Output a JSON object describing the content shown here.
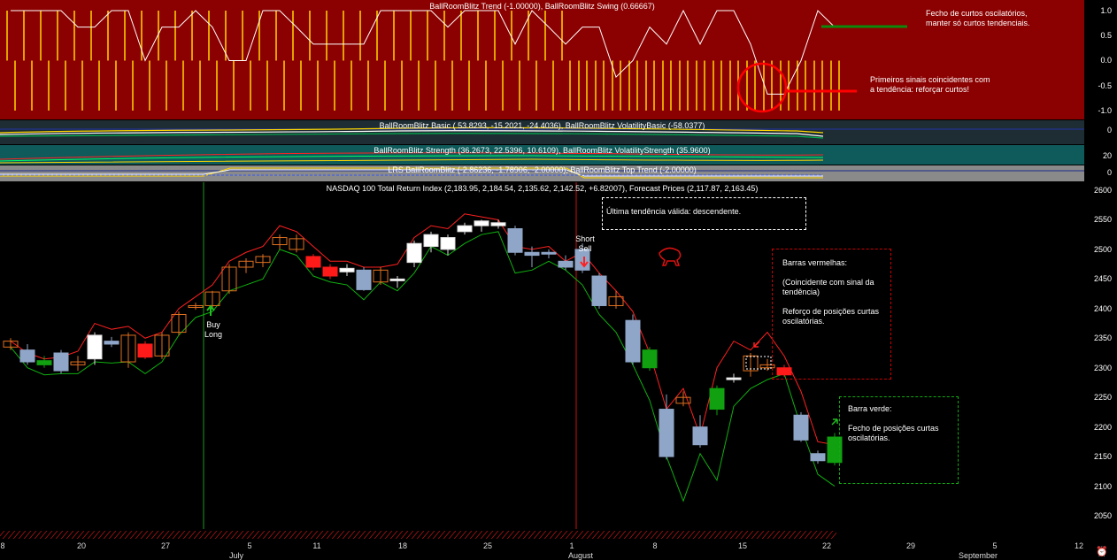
{
  "panels": {
    "trend": {
      "title": "BallRoomBlitz Trend (-1.00000), BallRoomBlitz Swing (0.66667)",
      "ticks": [
        "1.0",
        "0.5",
        "0.0",
        "-0.5",
        "-1.0"
      ],
      "ylim": [
        -1.0,
        1.0
      ],
      "colors": {
        "bg": "#8b0000",
        "bars": "#ffd700",
        "swing": "#ffffff",
        "green": "#0b8a0b",
        "red": "#ff0000"
      }
    },
    "basic": {
      "title": "BallRoomBlitz Basic ( 53.8293, -15.2021, -24.4036), BallRoomBlitz VolatilityBasic (-58.0377)",
      "ticks": [
        "0"
      ]
    },
    "strength": {
      "title": "BallRoomBlitz Strength (36.2673, 22.5396, 10.6109), BallRoomBlitz VolatilityStrength (35.9600)",
      "ticks": [
        "20",
        "0"
      ]
    },
    "lrs": {
      "title": "LRS BallRoomBlitz (-2.86236, -1.78906, -2.00000), BallRoomBlitz Top Trend (-2.00000)",
      "ticks": [
        "0"
      ]
    },
    "main": {
      "title": "NASDAQ 100 Total Return Index (2,183.95, 2,184.54, 2,135.62, 2,142.52, +6.82007), Forecast Prices (2,117.87, 2,163.45)",
      "ticks": [
        "2600",
        "2550",
        "2500",
        "2450",
        "2400",
        "2350",
        "2300",
        "2250",
        "2200",
        "2150",
        "2100",
        "2050"
      ]
    }
  },
  "annotations": {
    "trend_note1": "Fecho de curtos oscilatórios, manter só curtos tendenciais.",
    "trend_note2": "Primeiros sinais coincidentes com a tendência: reforçar curtos!",
    "box1": "Última tendência válida: descendente.",
    "box2_title": "Barras vermelhas:",
    "box2_line2": "(Coincidente com sinal da tendência)",
    "box2_line3": "Reforço de posições curtas oscilatórias.",
    "box3_title": "Barra verde:",
    "box3_line2": "Fecho de posições curtas oscilatórias.",
    "buy": "Buy Long",
    "sell": "Short Sell"
  },
  "x_axis": {
    "day_labels": [
      "8",
      "20",
      "27",
      "5",
      "11",
      "18",
      "25",
      "1",
      "8",
      "15",
      "22",
      "29",
      "5",
      "12"
    ],
    "month_labels": [
      "July",
      "August",
      "September"
    ]
  },
  "chart_data": {
    "type": "candlestick",
    "title": "NASDAQ 100 Total Return Index (2,183.95, 2,184.54, 2,135.62, 2,142.52, +6.82007), Forecast Prices (2,117.87, 2,163.45)",
    "ylim": [
      2025,
      2610
    ],
    "grid": false,
    "candles": [
      {
        "o": 2335,
        "h": 2350,
        "l": 2330,
        "c": 2345,
        "col": "orange"
      },
      {
        "o": 2330,
        "h": 2340,
        "l": 2305,
        "c": 2310,
        "col": "blue"
      },
      {
        "o": 2312,
        "h": 2320,
        "l": 2300,
        "c": 2305,
        "col": "green"
      },
      {
        "o": 2325,
        "h": 2330,
        "l": 2290,
        "c": 2295,
        "col": "blue"
      },
      {
        "o": 2305,
        "h": 2320,
        "l": 2295,
        "c": 2310,
        "col": "orange"
      },
      {
        "o": 2315,
        "h": 2360,
        "l": 2305,
        "c": 2355,
        "col": "white"
      },
      {
        "o": 2345,
        "h": 2352,
        "l": 2335,
        "c": 2340,
        "col": "blue"
      },
      {
        "o": 2310,
        "h": 2360,
        "l": 2300,
        "c": 2355,
        "col": "orange"
      },
      {
        "o": 2340,
        "h": 2345,
        "l": 2315,
        "c": 2318,
        "col": "red"
      },
      {
        "o": 2320,
        "h": 2360,
        "l": 2315,
        "c": 2355,
        "col": "orange"
      },
      {
        "o": 2360,
        "h": 2395,
        "l": 2355,
        "c": 2390,
        "col": "orange"
      },
      {
        "o": 2405,
        "h": 2410,
        "l": 2398,
        "c": 2403,
        "col": "orange"
      },
      {
        "o": 2405,
        "h": 2430,
        "l": 2400,
        "c": 2428,
        "col": "orange"
      },
      {
        "o": 2430,
        "h": 2475,
        "l": 2425,
        "c": 2470,
        "col": "orange"
      },
      {
        "o": 2470,
        "h": 2485,
        "l": 2460,
        "c": 2480,
        "col": "orange"
      },
      {
        "o": 2478,
        "h": 2492,
        "l": 2470,
        "c": 2488,
        "col": "orange"
      },
      {
        "o": 2508,
        "h": 2525,
        "l": 2500,
        "c": 2520,
        "col": "orange"
      },
      {
        "o": 2518,
        "h": 2525,
        "l": 2495,
        "c": 2500,
        "col": "orange"
      },
      {
        "o": 2488,
        "h": 2492,
        "l": 2465,
        "c": 2470,
        "col": "red"
      },
      {
        "o": 2470,
        "h": 2475,
        "l": 2450,
        "c": 2455,
        "col": "red"
      },
      {
        "o": 2462,
        "h": 2475,
        "l": 2455,
        "c": 2468,
        "col": "white"
      },
      {
        "o": 2465,
        "h": 2470,
        "l": 2430,
        "c": 2432,
        "col": "blue"
      },
      {
        "o": 2465,
        "h": 2470,
        "l": 2440,
        "c": 2445,
        "col": "orange"
      },
      {
        "o": 2448,
        "h": 2455,
        "l": 2435,
        "c": 2450,
        "col": "white"
      },
      {
        "o": 2478,
        "h": 2515,
        "l": 2470,
        "c": 2510,
        "col": "white"
      },
      {
        "o": 2525,
        "h": 2530,
        "l": 2495,
        "c": 2505,
        "col": "white"
      },
      {
        "o": 2500,
        "h": 2525,
        "l": 2490,
        "c": 2520,
        "col": "white"
      },
      {
        "o": 2530,
        "h": 2545,
        "l": 2525,
        "c": 2540,
        "col": "white"
      },
      {
        "o": 2540,
        "h": 2550,
        "l": 2530,
        "c": 2548,
        "col": "white"
      },
      {
        "o": 2545,
        "h": 2550,
        "l": 2535,
        "c": 2540,
        "col": "white"
      },
      {
        "o": 2535,
        "h": 2540,
        "l": 2490,
        "c": 2495,
        "col": "blue"
      },
      {
        "o": 2495,
        "h": 2505,
        "l": 2470,
        "c": 2490,
        "col": "blue"
      },
      {
        "o": 2495,
        "h": 2500,
        "l": 2485,
        "c": 2495,
        "col": "blue"
      },
      {
        "o": 2480,
        "h": 2490,
        "l": 2465,
        "c": 2470,
        "col": "blue"
      },
      {
        "o": 2500,
        "h": 2510,
        "l": 2460,
        "c": 2465,
        "col": "blue"
      },
      {
        "o": 2455,
        "h": 2460,
        "l": 2400,
        "c": 2405,
        "col": "blue"
      },
      {
        "o": 2420,
        "h": 2430,
        "l": 2400,
        "c": 2405,
        "col": "orange"
      },
      {
        "o": 2380,
        "h": 2390,
        "l": 2305,
        "c": 2310,
        "col": "blue"
      },
      {
        "o": 2330,
        "h": 2335,
        "l": 2295,
        "c": 2300,
        "col": "green"
      },
      {
        "o": 2230,
        "h": 2255,
        "l": 2145,
        "c": 2150,
        "col": "blue"
      },
      {
        "o": 2250,
        "h": 2260,
        "l": 2235,
        "c": 2240,
        "col": "orange"
      },
      {
        "o": 2200,
        "h": 2220,
        "l": 2165,
        "c": 2170,
        "col": "blue"
      },
      {
        "o": 2230,
        "h": 2270,
        "l": 2220,
        "c": 2265,
        "col": "green"
      },
      {
        "o": 2280,
        "h": 2290,
        "l": 2275,
        "c": 2283,
        "col": "white"
      },
      {
        "o": 2295,
        "h": 2325,
        "l": 2285,
        "c": 2320,
        "col": "orange"
      },
      {
        "o": 2305,
        "h": 2315,
        "l": 2295,
        "c": 2300,
        "col": "orange"
      },
      {
        "o": 2300,
        "h": 2305,
        "l": 2285,
        "c": 2288,
        "col": "red"
      },
      {
        "o": 2220,
        "h": 2225,
        "l": 2175,
        "c": 2178,
        "col": "blue"
      },
      {
        "o": 2155,
        "h": 2160,
        "l": 2138,
        "c": 2143,
        "col": "blue"
      },
      {
        "o": 2140,
        "h": 2190,
        "l": 2135,
        "c": 2183,
        "col": "green"
      }
    ],
    "forecast_high": [
      2345,
      2325,
      2315,
      2318,
      2328,
      2375,
      2365,
      2370,
      2350,
      2360,
      2400,
      2420,
      2440,
      2480,
      2495,
      2505,
      2540,
      2530,
      2505,
      2480,
      2480,
      2470,
      2470,
      2475,
      2520,
      2540,
      2535,
      2560,
      2555,
      2550,
      2505,
      2500,
      2505,
      2480,
      2495,
      2460,
      2430,
      2395,
      2325,
      2230,
      2265,
      2185,
      2300,
      2345,
      2330,
      2360,
      2320,
      2260,
      2175,
      2170
    ],
    "forecast_low": [
      2335,
      2300,
      2288,
      2290,
      2290,
      2310,
      2308,
      2310,
      2290,
      2310,
      2355,
      2385,
      2395,
      2430,
      2440,
      2450,
      2500,
      2490,
      2455,
      2445,
      2440,
      2415,
      2445,
      2430,
      2460,
      2505,
      2490,
      2510,
      2525,
      2530,
      2460,
      2465,
      2480,
      2465,
      2440,
      2390,
      2360,
      2305,
      2245,
      2150,
      2075,
      2155,
      2110,
      2235,
      2265,
      2280,
      2290,
      2200,
      2120,
      2100
    ],
    "y2_trend": [
      1,
      1,
      1,
      1,
      0.67,
      0.67,
      1,
      1,
      0,
      0.67,
      0.67,
      1,
      0.67,
      0,
      0,
      1,
      1,
      0.67,
      0.33,
      0.33,
      0.33,
      0.33,
      1,
      1,
      1,
      1,
      0.67,
      1,
      1,
      1,
      0.33,
      1,
      0.67,
      0.33,
      0.67,
      0.67,
      -0.33,
      0,
      0.67,
      0.33,
      1,
      0.33,
      1,
      1,
      0.33,
      -0.67,
      -0.67,
      0,
      1,
      0.67
    ]
  }
}
